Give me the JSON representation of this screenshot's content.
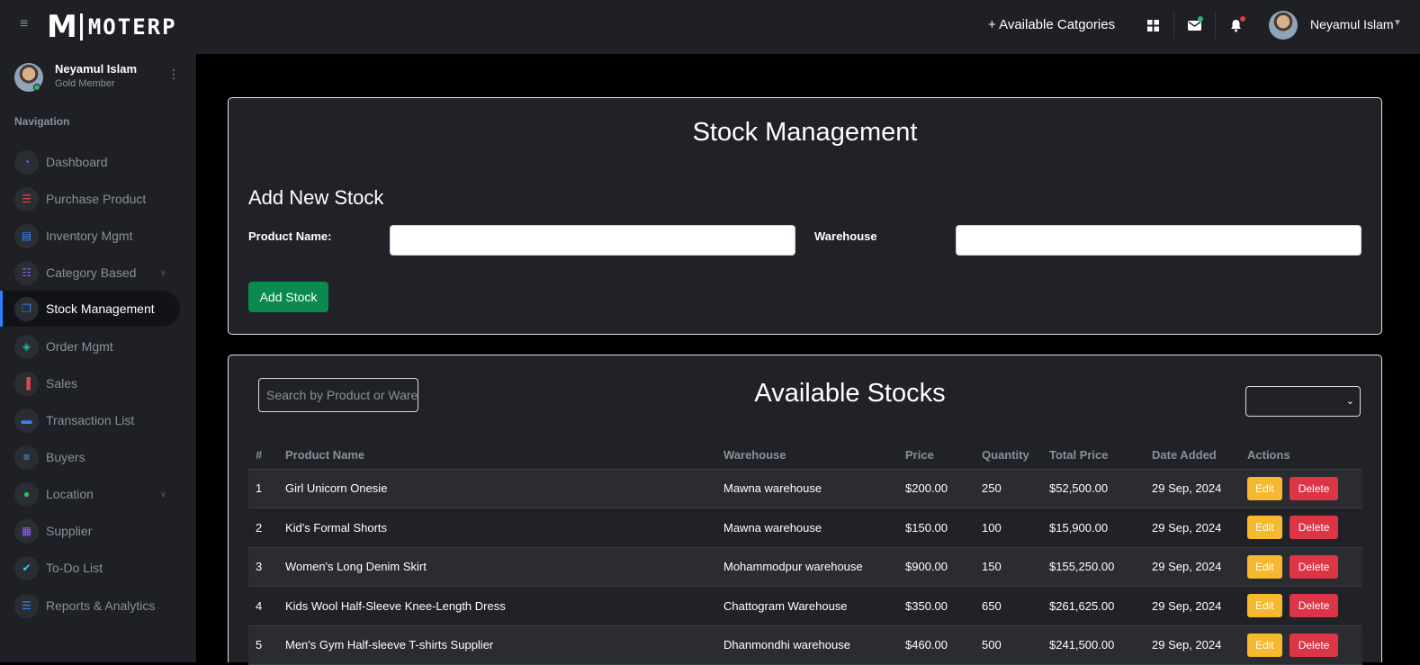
{
  "app": {
    "logo_mark": "M",
    "logo_text": "MOTERP"
  },
  "topbar": {
    "categories_link": "+ Available Catgories",
    "user_name": "Neyamul Islam",
    "icons": [
      "apps-grid-icon",
      "mail-icon",
      "bell-icon"
    ],
    "mail_dot_color": "#2fb36b",
    "bell_dot_color": "#e53935"
  },
  "sidebar": {
    "user": {
      "name": "Neyamul Islam",
      "role": "Gold Member"
    },
    "nav_title": "Navigation",
    "items": [
      {
        "label": "Dashboard",
        "icon": "speedometer-icon",
        "color": "#8b5cf6"
      },
      {
        "label": "Purchase Product",
        "icon": "list-icon",
        "color": "#e5484d"
      },
      {
        "label": "Inventory Mgmt",
        "icon": "scroll-icon",
        "color": "#3b82f6"
      },
      {
        "label": "Category Based",
        "icon": "checklist-icon",
        "color": "#8b5cf6",
        "expandable": true
      },
      {
        "label": "Stock Management",
        "icon": "copy-icon",
        "color": "#3b82f6",
        "active": true
      },
      {
        "label": "Order Mgmt",
        "icon": "layers-icon",
        "color": "#22b3a0"
      },
      {
        "label": "Sales",
        "icon": "bar-chart-icon",
        "color": "#e5484d"
      },
      {
        "label": "Transaction List",
        "icon": "card-icon",
        "color": "#3b82f6"
      },
      {
        "label": "Buyers",
        "icon": "wind-icon",
        "color": "#60a5fa"
      },
      {
        "label": "Location",
        "icon": "globe-icon",
        "color": "#22c55e",
        "expandable": true
      },
      {
        "label": "Supplier",
        "icon": "factory-icon",
        "color": "#8b5cf6"
      },
      {
        "label": "To-Do List",
        "icon": "check-circle-icon",
        "color": "#22d3ee"
      },
      {
        "label": "Reports & Analytics",
        "icon": "server-icon",
        "color": "#3b82f6"
      }
    ]
  },
  "stock_form": {
    "title": "Stock Management",
    "subtitle": "Add New Stock",
    "product_label": "Product Name:",
    "product_value": "",
    "warehouse_label": "Warehouse",
    "warehouse_value": "",
    "submit_label": "Add Stock"
  },
  "stocks": {
    "title": "Available Stocks",
    "search_placeholder": "Search by Product or Warehouse",
    "filter_value": "",
    "columns": [
      "#",
      "Product Name",
      "Warehouse",
      "Price",
      "Quantity",
      "Total Price",
      "Date Added",
      "Actions"
    ],
    "edit_label": "Edit",
    "delete_label": "Delete",
    "rows": [
      {
        "no": "1",
        "product": "Girl Unicorn Onesie",
        "warehouse": "Mawna warehouse",
        "price": "$200.00",
        "qty": "250",
        "total": "$52,500.00",
        "date": "29 Sep, 2024"
      },
      {
        "no": "2",
        "product": "Kid's Formal Shorts",
        "warehouse": "Mawna warehouse",
        "price": "$150.00",
        "qty": "100",
        "total": "$15,900.00",
        "date": "29 Sep, 2024"
      },
      {
        "no": "3",
        "product": "Women's Long Denim Skirt",
        "warehouse": "Mohammodpur warehouse",
        "price": "$900.00",
        "qty": "150",
        "total": "$155,250.00",
        "date": "29 Sep, 2024"
      },
      {
        "no": "4",
        "product": "Kids Wool Half-Sleeve Knee-Length Dress",
        "warehouse": "Chattogram Warehouse",
        "price": "$350.00",
        "qty": "650",
        "total": "$261,625.00",
        "date": "29 Sep, 2024"
      },
      {
        "no": "5",
        "product": "Men's Gym Half-sleeve T-shirts Supplier",
        "warehouse": "Dhanmondhi warehouse",
        "price": "$460.00",
        "qty": "500",
        "total": "$241,500.00",
        "date": "29 Sep, 2024"
      }
    ]
  }
}
